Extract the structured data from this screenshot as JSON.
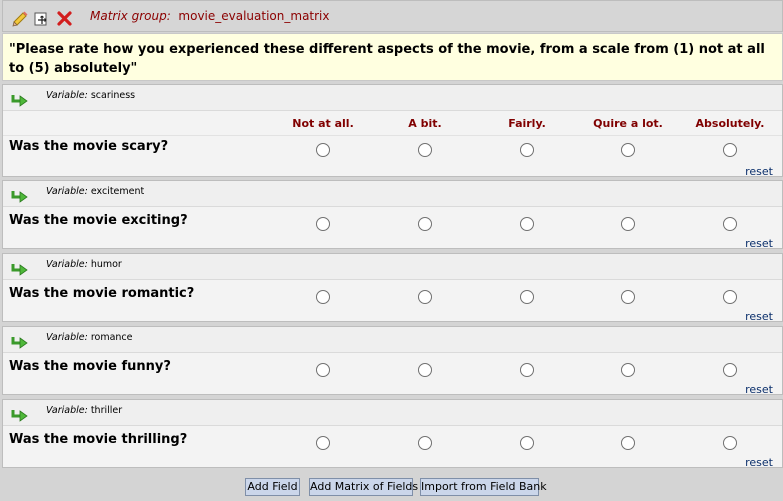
{
  "matrix_group": {
    "prefix": "Matrix group:",
    "name": "movie_evaluation_matrix"
  },
  "instructions": "\"Please rate how you experienced these different aspects of the movie, from a scale from (1) not at all to (5) absolutely\"",
  "variable_prefix": "Variable:",
  "columns": [
    "Not at all.",
    "A bit.",
    "Fairly.",
    "Quire a lot.",
    "Absolutely."
  ],
  "rows": [
    {
      "variable": "scariness",
      "question": "Was the movie scary?",
      "reset": "reset"
    },
    {
      "variable": "excitement",
      "question": "Was the movie exciting?",
      "reset": "reset"
    },
    {
      "variable": "humor",
      "question": "Was the movie romantic?",
      "reset": "reset"
    },
    {
      "variable": "romance",
      "question": "Was the movie funny?",
      "reset": "reset"
    },
    {
      "variable": "thriller",
      "question": "Was the movie thrilling?",
      "reset": "reset"
    }
  ],
  "buttons": {
    "add_field": "Add Field",
    "add_matrix": "Add Matrix of Fields",
    "import_bank": "Import from Field Bank"
  },
  "icons": {
    "edit": "pencil-icon",
    "move": "move-icon",
    "delete": "delete-x-icon",
    "branch": "branching-arrow-icon"
  }
}
